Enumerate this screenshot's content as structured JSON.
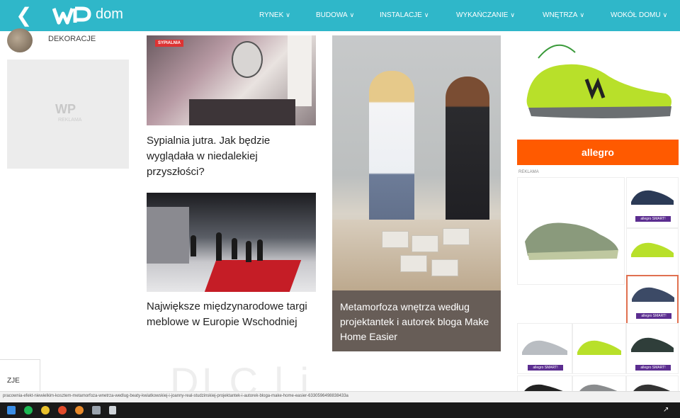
{
  "header": {
    "back_icon": "chevron-left-icon",
    "logo_mark": "WP",
    "logo_text": "dom",
    "nav": [
      {
        "label": "RYNEK"
      },
      {
        "label": "BUDOWA"
      },
      {
        "label": "INSTALACJE"
      },
      {
        "label": "WYKAŃCZANIE"
      },
      {
        "label": "WNĘTRZA"
      },
      {
        "label": "WOKÓŁ DOMU"
      }
    ],
    "color": "#2fb7c9"
  },
  "sidebar": {
    "category": "DEKORACJE",
    "ad_logo": "WP",
    "ad_text": "REKLAMA"
  },
  "articles": [
    {
      "badge": "SYPIALNIA",
      "title": "Sypialnia jutra. Jak będzie wyglądała w niedalekiej przyszłości?"
    },
    {
      "title": "Największe międzynarodowe targi meblowe w Europie Wschodniej"
    },
    {
      "title": "Metamorfoza wnętrza według projektantek i autorek bloga Make Home Easier"
    }
  ],
  "ads": {
    "allegro_label": "allegro",
    "allegro_color": "#ff5a00",
    "reklama": "REKLAMA",
    "chip_label": "allegro SMART!"
  },
  "footer": {
    "tab_label": "ZJE",
    "ghost_text": "DI C    l  i",
    "status_url": "pracownia-efekt-niewielkim-kosztem-metamorfoza-wnetrza-wedlug-beaty-kwiatkowskiej-i-joanny-real-studzinskiej-projektantek-i-autorek-bloga-make-home-easier-6330596498838433a"
  }
}
